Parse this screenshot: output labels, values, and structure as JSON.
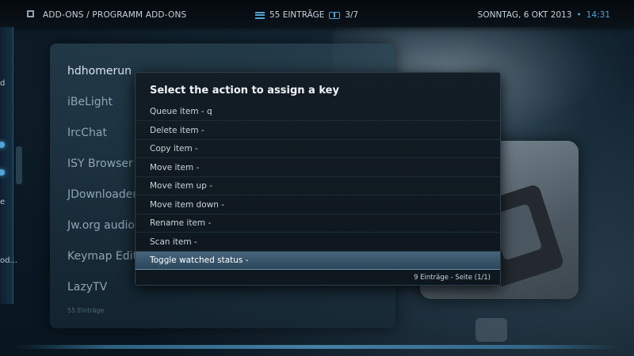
{
  "topbar": {
    "breadcrumb": "ADD-ONS / PROGRAMM ADD-ONS",
    "entries": "55 EINTRÄGE",
    "page": "3/7",
    "date": "SONNTAG, 6 OKT 2013",
    "separator": "•",
    "time": "14:31"
  },
  "sidebar": {
    "fragments": [
      "d",
      "e",
      "od..."
    ]
  },
  "background_list": {
    "items": [
      "hdhomerun",
      "iBeLight",
      "IrcChat",
      "ISY Browser",
      "JDownloader",
      "Jw.org audio/",
      "Keymap Edito",
      "LazyTV"
    ],
    "count": "55 Einträge"
  },
  "dialog": {
    "title": "Select the action to assign a key",
    "items": [
      "Queue item - q",
      "Delete item -",
      "Copy item -",
      "Move item -",
      "Move item up -",
      "Move item down -",
      "Rename item -",
      "Scan item -",
      "Toggle watched status -"
    ],
    "focused_index": 8,
    "footer": "9 Einträge - Seite (1/1)"
  },
  "colors": {
    "accent": "#4fa3d9",
    "focus": "#3a5a70"
  }
}
